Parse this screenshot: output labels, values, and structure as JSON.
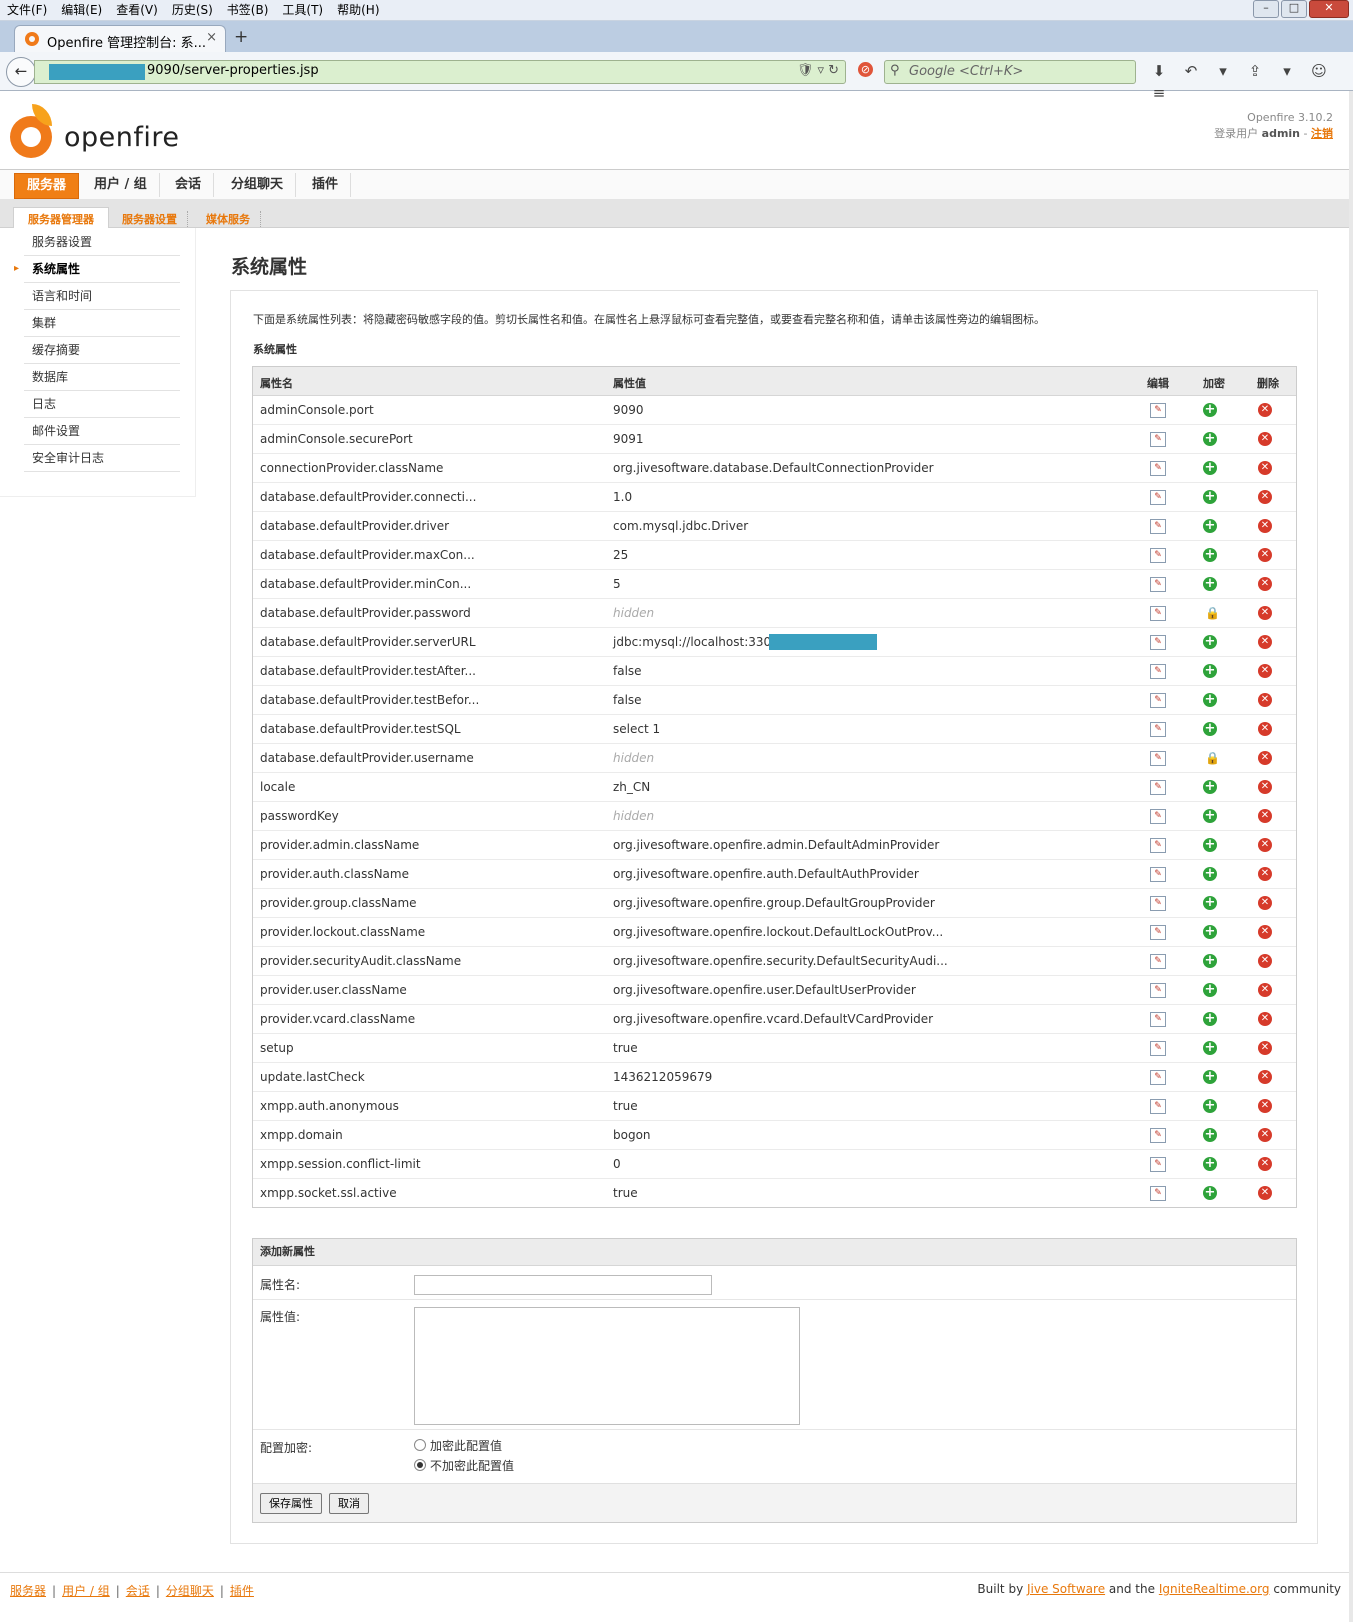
{
  "browser": {
    "menu": [
      "文件(F)",
      "编辑(E)",
      "查看(V)",
      "历史(S)",
      "书签(B)",
      "工具(T)",
      "帮助(H)"
    ],
    "tab_title": "Openfire 管理控制台: 系...",
    "tab_close": "×",
    "new_tab": "+",
    "url_suffix": "9090/server-properties.jsp",
    "search_placeholder": "Google <Ctrl+K>"
  },
  "header": {
    "logo_text": "openfire",
    "version": "Openfire 3.10.2",
    "login_prefix": "登录用户",
    "login_user": "admin",
    "logout": "注销"
  },
  "main_tabs": [
    "服务器",
    "用户 / 组",
    "会话",
    "分组聊天",
    "插件"
  ],
  "sub_tabs": [
    "服务器管理器",
    "服务器设置",
    "媒体服务"
  ],
  "sidebar": [
    "服务器设置",
    "系统属性",
    "语言和时间",
    "集群",
    "缓存摘要",
    "数据库",
    "日志",
    "邮件设置",
    "安全审计日志"
  ],
  "page": {
    "title": "系统属性",
    "intro": "下面是系统属性列表：将隐藏密码敏感字段的值。剪切长属性名和值。在属性名上悬浮鼠标可查看完整值，或要查看完整名称和值，请单击该属性旁边的编辑图标。",
    "section_label": "系统属性"
  },
  "table": {
    "headers": [
      "属性名",
      "属性值",
      "编辑",
      "加密",
      "删除"
    ],
    "rows": [
      {
        "name": "adminConsole.port",
        "value": "9090",
        "hidden": false,
        "encrypted": false
      },
      {
        "name": "adminConsole.securePort",
        "value": "9091",
        "hidden": false,
        "encrypted": false
      },
      {
        "name": "connectionProvider.className",
        "value": "org.jivesoftware.database.DefaultConnectionProvider",
        "hidden": false,
        "encrypted": false
      },
      {
        "name": "database.defaultProvider.connecti...",
        "value": "1.0",
        "hidden": false,
        "encrypted": false
      },
      {
        "name": "database.defaultProvider.driver",
        "value": "com.mysql.jdbc.Driver",
        "hidden": false,
        "encrypted": false
      },
      {
        "name": "database.defaultProvider.maxCon...",
        "value": "25",
        "hidden": false,
        "encrypted": false
      },
      {
        "name": "database.defaultProvider.minCon...",
        "value": "5",
        "hidden": false,
        "encrypted": false
      },
      {
        "name": "database.defaultProvider.password",
        "value": "hidden",
        "hidden": true,
        "encrypted": true
      },
      {
        "name": "database.defaultProvider.serverURL",
        "value": "jdbc:mysql://localhost:3306/c",
        "hidden": false,
        "encrypted": false,
        "masked": true
      },
      {
        "name": "database.defaultProvider.testAfter...",
        "value": "false",
        "hidden": false,
        "encrypted": false
      },
      {
        "name": "database.defaultProvider.testBefor...",
        "value": "false",
        "hidden": false,
        "encrypted": false
      },
      {
        "name": "database.defaultProvider.testSQL",
        "value": "select 1",
        "hidden": false,
        "encrypted": false
      },
      {
        "name": "database.defaultProvider.username",
        "value": "hidden",
        "hidden": true,
        "encrypted": true
      },
      {
        "name": "locale",
        "value": "zh_CN",
        "hidden": false,
        "encrypted": false
      },
      {
        "name": "passwordKey",
        "value": "hidden",
        "hidden": true,
        "encrypted": false
      },
      {
        "name": "provider.admin.className",
        "value": "org.jivesoftware.openfire.admin.DefaultAdminProvider",
        "hidden": false,
        "encrypted": false
      },
      {
        "name": "provider.auth.className",
        "value": "org.jivesoftware.openfire.auth.DefaultAuthProvider",
        "hidden": false,
        "encrypted": false
      },
      {
        "name": "provider.group.className",
        "value": "org.jivesoftware.openfire.group.DefaultGroupProvider",
        "hidden": false,
        "encrypted": false
      },
      {
        "name": "provider.lockout.className",
        "value": "org.jivesoftware.openfire.lockout.DefaultLockOutProv...",
        "hidden": false,
        "encrypted": false
      },
      {
        "name": "provider.securityAudit.className",
        "value": "org.jivesoftware.openfire.security.DefaultSecurityAudi...",
        "hidden": false,
        "encrypted": false
      },
      {
        "name": "provider.user.className",
        "value": "org.jivesoftware.openfire.user.DefaultUserProvider",
        "hidden": false,
        "encrypted": false
      },
      {
        "name": "provider.vcard.className",
        "value": "org.jivesoftware.openfire.vcard.DefaultVCardProvider",
        "hidden": false,
        "encrypted": false
      },
      {
        "name": "setup",
        "value": "true",
        "hidden": false,
        "encrypted": false
      },
      {
        "name": "update.lastCheck",
        "value": "1436212059679",
        "hidden": false,
        "encrypted": false
      },
      {
        "name": "xmpp.auth.anonymous",
        "value": "true",
        "hidden": false,
        "encrypted": false
      },
      {
        "name": "xmpp.domain",
        "value": "bogon",
        "hidden": false,
        "encrypted": false
      },
      {
        "name": "xmpp.session.conflict-limit",
        "value": "0",
        "hidden": false,
        "encrypted": false
      },
      {
        "name": "xmpp.socket.ssl.active",
        "value": "true",
        "hidden": false,
        "encrypted": false
      }
    ]
  },
  "add_form": {
    "title": "添加新属性",
    "name_label": "属性名:",
    "value_label": "属性值:",
    "encrypt_label": "配置加密:",
    "encrypt_option": "加密此配置值",
    "noencrypt_option": "不加密此配置值",
    "selected": "noencrypt",
    "save_button": "保存属性",
    "cancel_button": "取消"
  },
  "footer": {
    "links": [
      "服务器",
      "用户 / 组",
      "会话",
      "分组聊天",
      "插件"
    ],
    "built_by": "Built by",
    "jive": "Jive Software",
    "and_the": "and the",
    "ignite": "IgniteRealtime.org",
    "community": "community"
  },
  "colors": {
    "accent": "#f07f15",
    "link": "#e8780c",
    "url_bg": "#dbefcf"
  }
}
